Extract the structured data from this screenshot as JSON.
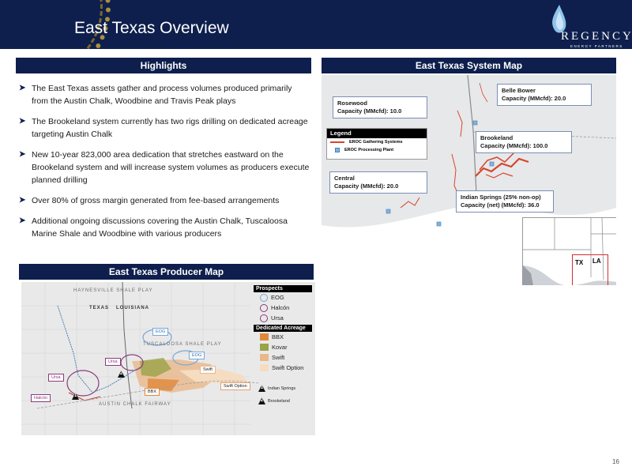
{
  "slide": {
    "title": "East Texas Overview",
    "page_number": "16"
  },
  "logo": {
    "word": "REGENCY",
    "sub": "ENERGY PARTNERS"
  },
  "highlights": {
    "header": "Highlights",
    "items": [
      "The East Texas assets gather and process volumes produced primarily from the Austin Chalk, Woodbine and Travis Peak plays",
      "The Brookeland system currently has two rigs drilling on dedicated acreage targeting Austin Chalk",
      "New 10-year 823,000 area dedication that stretches eastward on the Brookeland system and will increase system volumes as producers execute planned drilling",
      "Over 80% of gross margin generated from fee-based arrangements",
      "Additional ongoing discussions covering the Austin Chalk, Tuscaloosa Marine Shale and Woodbine with various producers"
    ]
  },
  "system_map": {
    "header": "East Texas System Map",
    "callouts": {
      "rosewood": {
        "name": "Rosewood",
        "capacity": "Capacity (MMcfd): 10.0"
      },
      "belle_bower": {
        "name": "Belle Bower",
        "capacity": "Capacity (MMcfd): 20.0"
      },
      "brookeland": {
        "name": "Brookeland",
        "capacity": "Capacity (MMcfd): 100.0"
      },
      "central": {
        "name": "Central",
        "capacity": "Capacity (MMcfd): 20.0"
      },
      "indian_springs": {
        "name": "Indian Springs (25% non-op)",
        "capacity": "Capacity (net) (MMcfd): 36.0"
      }
    },
    "legend": {
      "title": "Legend",
      "gathering": "EROC Gathering Systems",
      "processing": "EROC Processing Plant"
    },
    "inset": {
      "tx": "TX",
      "la": "LA"
    }
  },
  "producer_map": {
    "header": "East Texas Producer Map",
    "labels": {
      "haynesville": "HAYNESVILLE SHALE PLAY",
      "texas": "TEXAS",
      "louisiana": "LOUISIANA",
      "tuscaloosa": "TUSCALOOSA SHALE PLAY",
      "austin_chalk": "AUSTIN CHALK FAIRWAY"
    },
    "tags": {
      "eog1": "EOG",
      "eog2": "EOG",
      "ursa1": "Ursa",
      "ursa2": "Ursa",
      "halcon": "Halcón",
      "swift": "Swift",
      "swift_option": "Swift Option",
      "bbx": "BBX"
    },
    "markers": {
      "one": "1",
      "two": "2"
    },
    "legend": {
      "prospects_title": "Prospects",
      "prospects": [
        "EOG",
        "Halcón",
        "Ursa"
      ],
      "acreage_title": "Dedicated Acreage",
      "acreage": [
        "BBX",
        "Kovar",
        "Swift",
        "Swift Option"
      ],
      "markers": [
        "Indian Springs",
        "Brookeland"
      ]
    }
  },
  "colors": {
    "navy": "#0e1f4d",
    "pipeline": "#d6452a",
    "bbx": "#e0883a",
    "kovar": "#9aa24a",
    "swift": "#e8b88a",
    "swift_option": "#f6dcc0"
  }
}
